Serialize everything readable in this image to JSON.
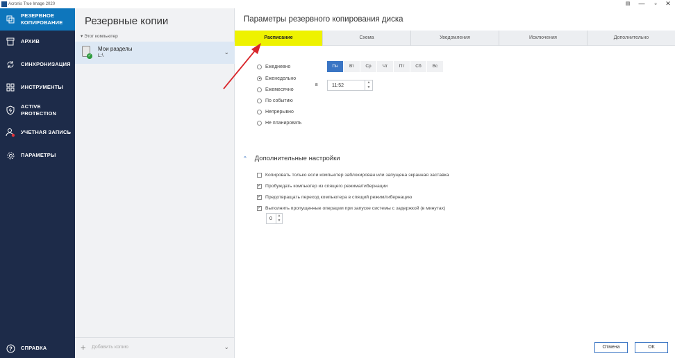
{
  "window": {
    "title": "Acronis True Image 2020"
  },
  "sidebar": {
    "items": [
      {
        "label": "Резервное копирование",
        "icon": "copy-icon",
        "active": true
      },
      {
        "label": "Архив",
        "icon": "archive-icon"
      },
      {
        "label": "Синхронизация",
        "icon": "sync-icon"
      },
      {
        "label": "Инструменты",
        "icon": "grid-icon"
      },
      {
        "label": "Active Protection",
        "icon": "shield-icon"
      },
      {
        "label": "Учетная запись",
        "icon": "user-icon"
      },
      {
        "label": "Параметры",
        "icon": "gear-icon"
      }
    ],
    "help_label": "Справка"
  },
  "middle": {
    "title": "Резервные копии",
    "section_label": "Этот компьютер",
    "backup": {
      "name": "Мои разделы",
      "path": "L:\\"
    },
    "add_label": "Добавить копию"
  },
  "content": {
    "title": "Параметры резервного копирования диска",
    "tabs": [
      "Расписание",
      "Схема",
      "Уведомления",
      "Исключения",
      "Дополнительно"
    ],
    "active_tab": "Расписание",
    "schedule_options": [
      "Ежедневно",
      "Еженедельно",
      "Ежемесячно",
      "По событию",
      "Непрерывно",
      "Не планировать"
    ],
    "selected_option": "Еженедельно",
    "days": [
      "Пн",
      "Вт",
      "Ср",
      "Чт",
      "Пт",
      "Сб",
      "Вс"
    ],
    "selected_days": [
      "Пн"
    ],
    "at_label": "в",
    "time": "11:52",
    "advanced_title": "Дополнительные настройки",
    "advanced_options": [
      {
        "label": "Копировать только если компьютер заблокирован или запущена экранная заставка",
        "checked": false
      },
      {
        "label": "Пробуждать компьютер из спящего режима/гибернации",
        "checked": true
      },
      {
        "label": "Предотвращать переход компьютера в спящий режим/гибернацию",
        "checked": true
      },
      {
        "label": "Выполнить пропущенные операции при запуске системы с задержкой (в минутах)",
        "checked": true
      }
    ],
    "delay_value": "0",
    "cancel_label": "Отмена",
    "ok_label": "ОК"
  },
  "colors": {
    "sidebar_bg": "#1d2b49",
    "nav_active": "#0e76bc",
    "tab_highlight": "#eef200",
    "accent": "#3a75c4",
    "annotation_arrow": "#d9262b"
  }
}
